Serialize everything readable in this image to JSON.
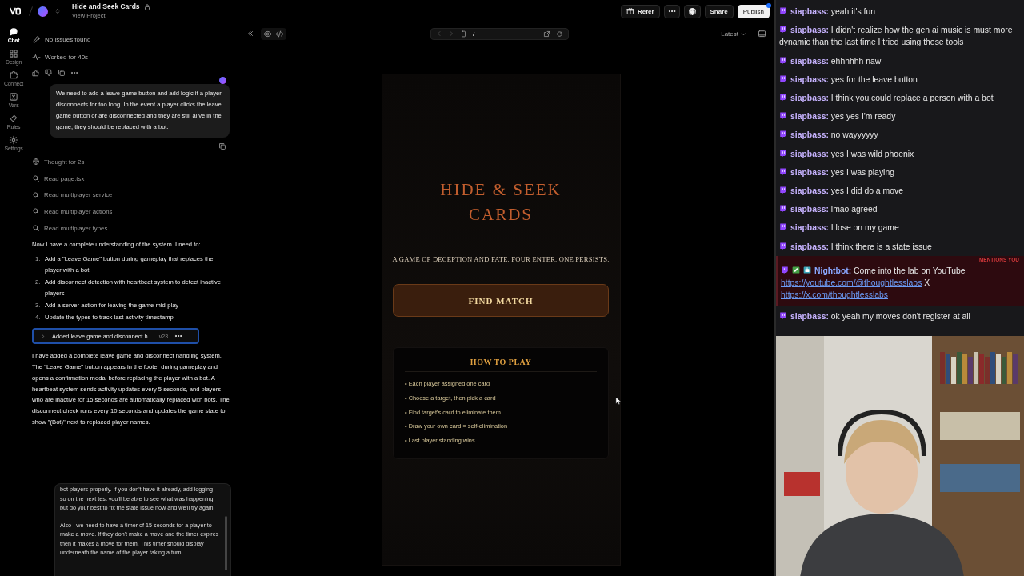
{
  "project": {
    "title": "Hide and Seek Cards",
    "subtitle": "View Project",
    "locked": true
  },
  "top_actions": [
    {
      "kind": "refer",
      "label": "Refer"
    },
    {
      "kind": "more"
    },
    {
      "kind": "github"
    },
    {
      "kind": "plain",
      "label": "Share"
    },
    {
      "kind": "primary",
      "label": "Publish",
      "notify": true
    }
  ],
  "rail": [
    {
      "kind": "chat",
      "label": "Chat",
      "selected": true
    },
    {
      "kind": "design",
      "label": "Design",
      "selected": false
    },
    {
      "kind": "connect",
      "label": "Connect",
      "selected": false
    },
    {
      "kind": "vars",
      "label": "Vars",
      "selected": false
    },
    {
      "kind": "rules",
      "label": "Rules",
      "selected": false
    },
    {
      "kind": "settings",
      "label": "Settings",
      "selected": false
    }
  ],
  "status_lines": [
    {
      "kind": "wrench",
      "text": "No issues found"
    },
    {
      "kind": "pulse",
      "text": "Worked for 40s"
    }
  ],
  "user_message": "We need to add a leave game button and add logic if a player disconnects for too long. In the event a player clicks the leave game button or are disconnected and they are still alive in the game, they should be replaced with a bot.",
  "steps": [
    {
      "kind": "thought",
      "text": "Thought for 2s"
    },
    {
      "kind": "search",
      "text": "Read page.tsx"
    },
    {
      "kind": "search",
      "text": "Read multiplayer service"
    },
    {
      "kind": "search",
      "text": "Read multiplayer actions"
    },
    {
      "kind": "search",
      "text": "Read multiplayer types"
    }
  ],
  "assistant_intro": "Now I have a complete understanding of the system. I need to:",
  "plan": [
    {
      "number": "1.",
      "text": "Add a \"Leave Game\" button during gameplay that replaces the player with a bot"
    },
    {
      "number": "2.",
      "text": "Add disconnect detection with heartbeat system to detect inactive players"
    },
    {
      "number": "3.",
      "text": "Add a server action for leaving the game mid-play"
    },
    {
      "number": "4.",
      "text": "Update the types to track last activity timestamp"
    }
  ],
  "version_card": {
    "title": "Added leave game and disconnect h...",
    "version": "v23",
    "selected": true
  },
  "summary": "I have added a complete leave game and disconnect handling system. The \"Leave Game\" button appears in the footer during gameplay and opens a confirmation modal before replacing the player with a bot. A heartbeat system sends activity updates every 5 seconds, and players who are inactive for 15 seconds are automatically replaced with bots. The disconnect check runs every 10 seconds and updates the game state to show \"(Bot)\" next to replaced player names.",
  "prompt": {
    "paragraphs": [
      "bot players properly. If you don't have it already, add logging so on the next test you'll be able to see what was happening. but do your best to fix the state issue now and we'll try again.",
      "Also - we need to have a timer of 15 seconds for a player to make a move. If they don't make a move and the timer expires then it makes a move for them. This timer should display underneath the name of the player taking a turn."
    ]
  },
  "preview_bar": {
    "path": "/",
    "version": "Latest"
  },
  "game": {
    "title_lines": [
      "HIDE & SEEK",
      "CARDS"
    ],
    "tagline": "A GAME OF DECEPTION AND FATE. FOUR ENTER. ONE PERSISTS.",
    "button": "FIND MATCH",
    "how_to_play": {
      "heading": "HOW TO PLAY",
      "items": [
        "• Each player assigned one card",
        "• Choose a target, then pick a card",
        "• Find target's card to eliminate them",
        "• Draw your own card = self-elimination",
        "• Last player standing wins"
      ]
    }
  },
  "stream_chat": [
    {
      "kind": "message",
      "user": "siapbass:",
      "text": "yeah it's fun"
    },
    {
      "kind": "message",
      "user": "siapbass:",
      "text": "I didn't realize how the gen ai music is must more dynamic than the last time I tried using those tools"
    },
    {
      "kind": "message",
      "user": "siapbass:",
      "text": "ehhhhhh naw"
    },
    {
      "kind": "message",
      "user": "siapbass:",
      "text": "yes for the leave button"
    },
    {
      "kind": "message",
      "user": "siapbass:",
      "text": "I think you could replace a person with a bot"
    },
    {
      "kind": "message",
      "user": "siapbass:",
      "text": "yes yes I'm ready"
    },
    {
      "kind": "message",
      "user": "siapbass:",
      "text": "no wayyyyyy"
    },
    {
      "kind": "message",
      "user": "siapbass:",
      "text": "yes I was wild phoenix"
    },
    {
      "kind": "message",
      "user": "siapbass:",
      "text": "yes I was playing"
    },
    {
      "kind": "message",
      "user": "siapbass:",
      "text": "yes I did do a move"
    },
    {
      "kind": "message",
      "user": "siapbass:",
      "text": "lmao agreed"
    },
    {
      "kind": "message",
      "user": "siapbass:",
      "text": "I lose on my game"
    },
    {
      "kind": "message",
      "user": "siapbass:",
      "text": "I think there is a state issue"
    },
    {
      "kind": "mention",
      "user": "Nightbot:",
      "mention_label": "MENTIONS YOU",
      "text": "Come into the lab on YouTube",
      "links": [
        "https://youtube.com/@thoughtlesslabs",
        "https://x.com/thoughtlesslabs"
      ],
      "separator": "X"
    },
    {
      "kind": "message",
      "user": "siapbass:",
      "text": "ok yeah my moves don't register at all"
    }
  ]
}
